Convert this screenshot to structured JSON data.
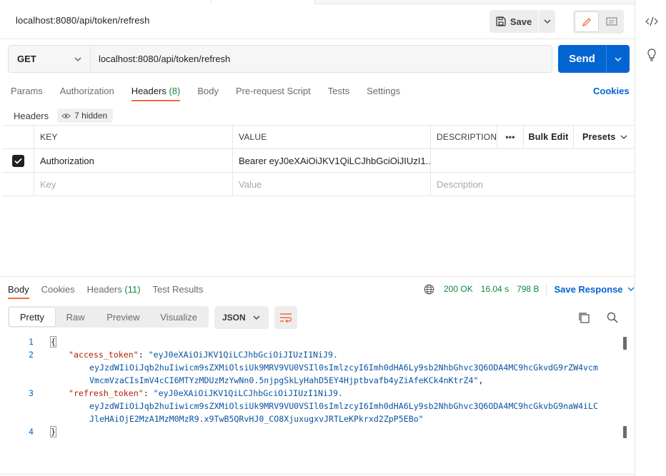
{
  "request": {
    "title": "localhost:8080/api/token/refresh",
    "save_label": "Save",
    "method": "GET",
    "url": "localhost:8080/api/token/refresh",
    "send_label": "Send"
  },
  "request_tabs": [
    {
      "label": "Params"
    },
    {
      "label": "Authorization"
    },
    {
      "label": "Headers",
      "count": "(8)"
    },
    {
      "label": "Body"
    },
    {
      "label": "Pre-request Script"
    },
    {
      "label": "Tests"
    },
    {
      "label": "Settings"
    }
  ],
  "cookies_label": "Cookies",
  "headers_section": {
    "title": "Headers",
    "hidden_label": "7 hidden"
  },
  "headers_table": {
    "columns": {
      "key": "KEY",
      "value": "VALUE",
      "description": "DESCRIPTION",
      "more": "•••",
      "bulk_edit": "Bulk Edit",
      "presets": "Presets"
    },
    "rows": [
      {
        "key": "Authorization",
        "value": "Bearer eyJ0eXAiOiJKV1QiLCJhbGciOiJIUzI1...",
        "description": "",
        "checked": true
      }
    ],
    "placeholder": {
      "key": "Key",
      "value": "Value",
      "description": "Description"
    }
  },
  "response": {
    "tabs": [
      {
        "label": "Body"
      },
      {
        "label": "Cookies"
      },
      {
        "label": "Headers",
        "count": "(11)"
      },
      {
        "label": "Test Results"
      }
    ],
    "status": "200 OK",
    "time": "16.04 s",
    "size": "798 B",
    "save_response_label": "Save Response",
    "view_modes": [
      "Pretty",
      "Raw",
      "Preview",
      "Visualize"
    ],
    "format": "JSON",
    "code": {
      "line_numbers": [
        "1",
        "2",
        "3",
        "4"
      ],
      "open_brace": "{",
      "close_brace": "}",
      "access_key": "\"access_token\"",
      "access_value_1": "\"eyJ0eXAiOiJKV1QiLCJhbGciOiJIUzI1NiJ9.",
      "access_value_2": "eyJzdWIiOiJqb2huIiwicm9sZXMiOlsiUk9MRV9VU0VSIl0sImlzcyI6Imh0dHA6Ly9sb2NhbGhvc3Q6ODA4MC9hcGkvdG9rZW4vcm",
      "access_value_3": "VmcmVzaCIsImV4cCI6MTYzMDUzMzYwNn0.5njpgSkLyHahD5EY4Hjptbvafb4yZiAfeKCk4nKtrZ4\"",
      "refresh_key": "\"refresh_token\"",
      "refresh_value_1": "\"eyJ0eXAiOiJKV1QiLCJhbGciOiJIUzI1NiJ9.",
      "refresh_value_2": "eyJzdWIiOiJqb2huIiwicm9sZXMiOlsiUk9MRV9VU0VSIl0sImlzcyI6Imh0dHA6Ly9sb2NhbGhvc3Q6ODA4MC9hcGkvbG9naW4iLC",
      "refresh_value_3": "JleHAiOjE2MzA1MzM0MzR9.x9TwB5QRvHJ0_CO8XjuxugxvJRTLeKPkrxd2ZpP5EBo\""
    }
  },
  "colors": {
    "accent_orange": "#f26b3a",
    "primary_blue": "#0265d2",
    "success_green": "#0b8a3f"
  },
  "icons": [
    "save-icon",
    "chevron-down-icon",
    "pencil-icon",
    "comment-icon",
    "code-icon",
    "lightbulb-icon",
    "eye-icon",
    "globe-icon",
    "wrap-lines-icon",
    "copy-icon",
    "search-icon"
  ]
}
